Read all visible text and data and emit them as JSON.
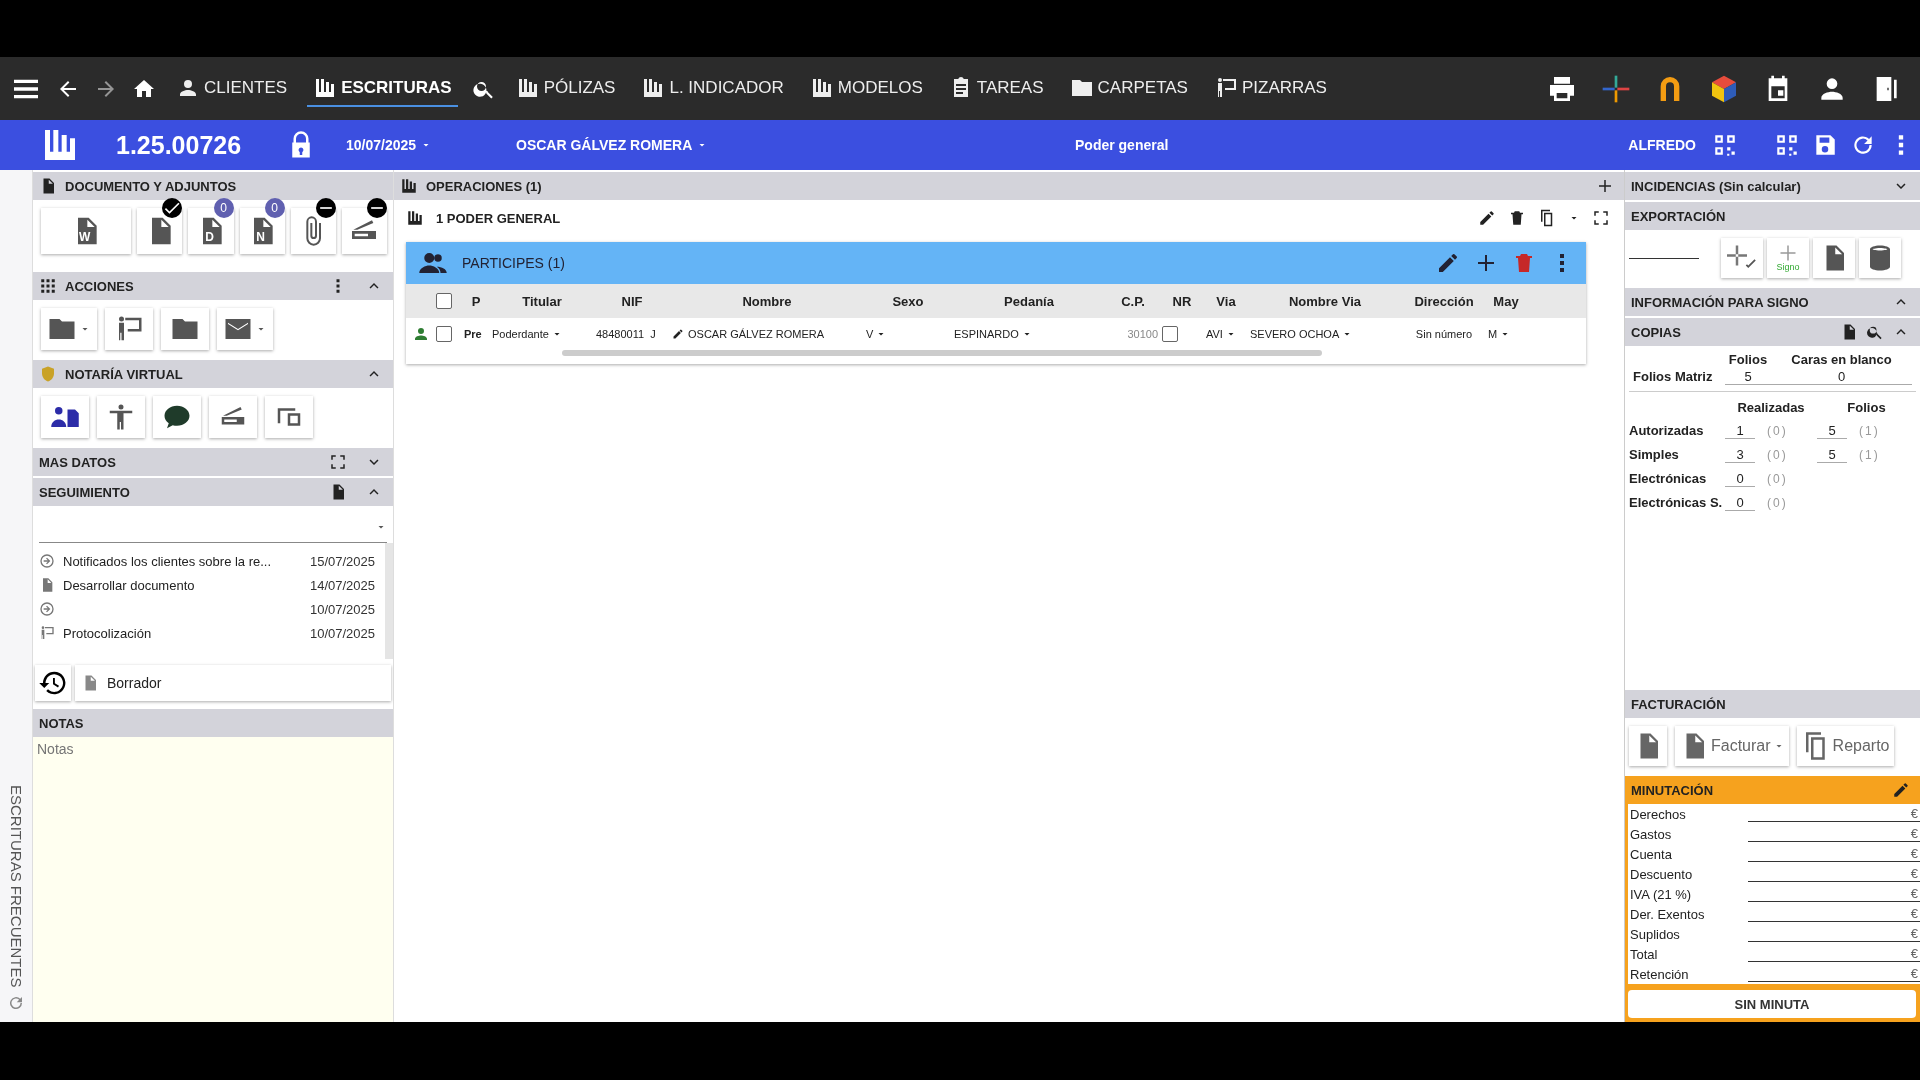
{
  "nav": {
    "items": [
      {
        "label": "CLIENTES",
        "selected": false
      },
      {
        "label": "ESCRITURAS",
        "selected": true
      },
      {
        "label": "PÓLIZAS",
        "selected": false
      },
      {
        "label": "L. INDICADOR",
        "selected": false
      },
      {
        "label": "MODELOS",
        "selected": false
      },
      {
        "label": "TAREAS",
        "selected": false
      },
      {
        "label": "CARPETAS",
        "selected": false
      },
      {
        "label": "PIZARRAS",
        "selected": false
      }
    ]
  },
  "header": {
    "number": "1.25.00726",
    "date": "10/07/2025",
    "client": "OSCAR GÁLVEZ ROMERA",
    "title": "Poder general",
    "user": "ALFREDO"
  },
  "side_tab": {
    "label": "ESCRITURAS FRECUENTES"
  },
  "documents": {
    "title": "DOCUMENTO Y ADJUNTOS",
    "buttons": [
      {
        "kind": "word",
        "letter": "W"
      },
      {
        "kind": "preview",
        "badge": {
          "kind": "check"
        }
      },
      {
        "kind": "d-doc",
        "letter": "D",
        "badge": {
          "kind": "count",
          "text": "0"
        }
      },
      {
        "kind": "n-doc",
        "letter": "N",
        "badge": {
          "kind": "count",
          "text": "0"
        }
      },
      {
        "kind": "attachment",
        "badge": {
          "kind": "minus"
        }
      },
      {
        "kind": "scanner",
        "badge": {
          "kind": "minus"
        }
      }
    ]
  },
  "actions": {
    "title": "ACCIONES"
  },
  "virtual": {
    "title": "NOTARÍA VIRTUAL"
  },
  "more": {
    "title": "MAS DATOS"
  },
  "tracking": {
    "title": "SEGUIMIENTO",
    "rows": [
      {
        "kind": "notify",
        "text": "Notificados los clientes sobre la re...",
        "date": "15/07/2025"
      },
      {
        "kind": "document",
        "text": "Desarrollar documento",
        "date": "14/07/2025"
      },
      {
        "kind": "notify",
        "date": "10/07/2025"
      },
      {
        "kind": "protocol",
        "text": "Protocolización",
        "date": "10/07/2025"
      }
    ],
    "status": "Borrador"
  },
  "notes": {
    "title": "NOTAS",
    "placeholder": "Notas"
  },
  "operations": {
    "title": "OPERACIONES (1)",
    "item": "1 PODER GENERAL"
  },
  "participants": {
    "title": "PARTICIPES (1)",
    "columns": [
      "P",
      "Titular",
      "NIF",
      "Nombre",
      "Sexo",
      "Pedanía",
      "C.P.",
      "NR",
      "Via",
      "Nombre Via",
      "Dirección",
      "May"
    ],
    "select_all": false,
    "rows": [
      {
        "checked": false,
        "p": "Pre",
        "titular": "Poderdante",
        "nif": "48480011",
        "nif_letter": "J",
        "nombre": "OSCAR GÁLVEZ ROMERA",
        "sexo": "V",
        "pedania": "ESPINARDO",
        "cp": "30100",
        "nr": false,
        "via": "AVI",
        "nombre_via": "SEVERO OCHOA",
        "direccion": "Sin número",
        "mayor": "M"
      }
    ]
  },
  "incidents": {
    "title": "INCIDENCIAS (Sin calcular)"
  },
  "export": {
    "title": "EXPORTACIÓN",
    "sign_label": "Signo"
  },
  "sign_info": {
    "title": "INFORMACIÓN PARA SIGNO"
  },
  "copies": {
    "title": "COPIAS",
    "matrix_headers": [
      "Folios",
      "Caras en blanco"
    ],
    "matrix": {
      "label": "Folios Matriz",
      "folios": "5",
      "caras": "0"
    },
    "headers": [
      "Realizadas",
      "Folios"
    ],
    "rows": [
      {
        "label": "Autorizadas",
        "done": "1",
        "done_note": "(0)",
        "folios": "5",
        "folios_note": "(1)"
      },
      {
        "label": "Simples",
        "done": "3",
        "done_note": "(0)",
        "folios": "5",
        "folios_note": "(1)"
      },
      {
        "label": "Electrónicas",
        "done": "0",
        "done_note": "(0)"
      },
      {
        "label": "Electrónicas S.",
        "done": "0",
        "done_note": "(0)"
      }
    ]
  },
  "billing": {
    "title": "FACTURACIÓN",
    "invoice": "Facturar",
    "split": "Reparto"
  },
  "fees": {
    "title": "MINUTACIÓN",
    "rows": [
      {
        "label": "Derechos",
        "currency": "€"
      },
      {
        "label": "Gastos",
        "currency": "€"
      },
      {
        "label": "Cuenta",
        "currency": "€"
      },
      {
        "label": "Descuento",
        "currency": "€"
      },
      {
        "label": "IVA (21 %)",
        "currency": "€"
      },
      {
        "label": "Der. Exentos",
        "currency": "€"
      },
      {
        "label": "Suplidos",
        "currency": "€"
      },
      {
        "label": "Total",
        "currency": "€"
      },
      {
        "label": "Retención",
        "currency": "€"
      }
    ],
    "button": "SIN MINUTA"
  }
}
